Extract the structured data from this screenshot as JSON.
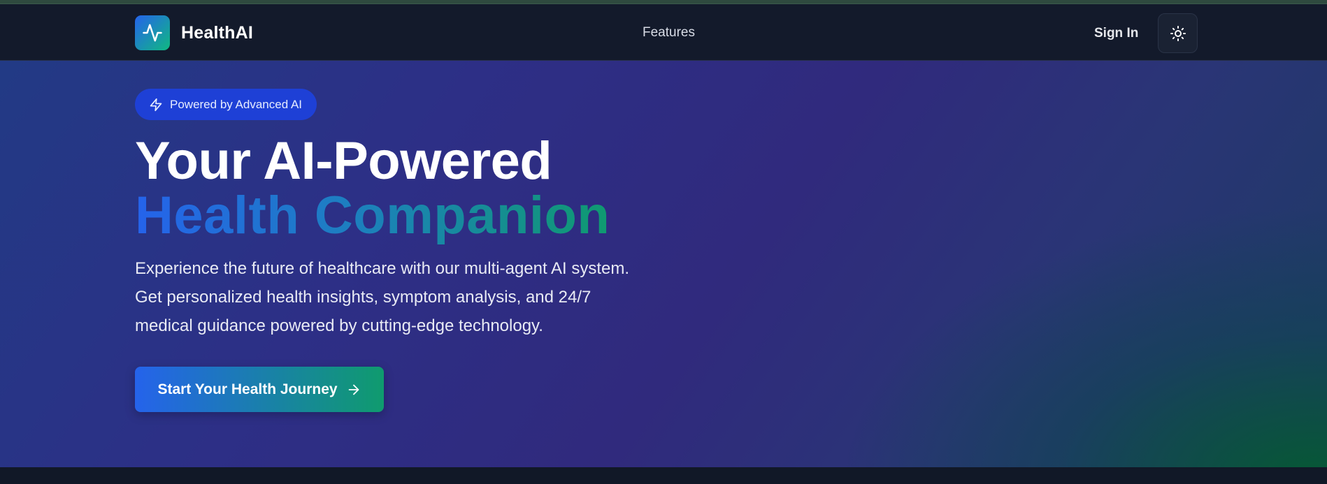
{
  "brand": {
    "name": "HealthAI",
    "logo_icon": "activity-pulse-icon"
  },
  "nav": {
    "features_label": "Features",
    "signin_label": "Sign In",
    "theme_toggle_icon": "sun-icon"
  },
  "hero": {
    "badge_icon": "lightning-icon",
    "badge_label": "Powered by Advanced AI",
    "headline_line1": "Your AI-Powered",
    "headline_line2": "Health Companion",
    "description": "Experience the future of healthcare with our multi-agent AI system. Get personalized health insights, symptom analysis, and 24/7 medical guidance powered by cutting-edge technology.",
    "cta_label": "Start Your Health Journey",
    "cta_icon": "arrow-right-icon"
  },
  "colors": {
    "accent_blue": "#2563eb",
    "accent_green": "#10b981",
    "nav_background": "#131a2b"
  }
}
